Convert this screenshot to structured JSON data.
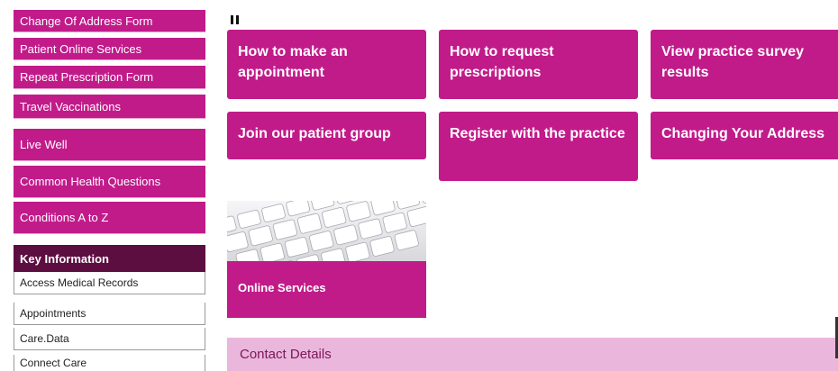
{
  "sidebar": {
    "forms": [
      "Change Of Address Form",
      "Patient Online Services",
      "Repeat Prescription Form",
      "Travel Vaccinations"
    ],
    "health": [
      "Live Well",
      "Common Health Questions",
      "Conditions A to Z"
    ],
    "key_information": {
      "title": "Key Information",
      "items": [
        "Access Medical Records",
        "Appointments",
        "Care.Data",
        "Connect Care"
      ]
    }
  },
  "main": {
    "tiles": [
      "How to make an appointment",
      "How to request prescriptions",
      "View practice survey results",
      "Join our patient group",
      "Register with the practice",
      "Changing Your Address"
    ],
    "online_services": {
      "label": "Online Services",
      "image": "keyboard-image"
    },
    "contact_details": "Contact Details"
  },
  "icons": {
    "slideshow_control": "pause-icon"
  },
  "colors": {
    "brand": "#c11b8a",
    "header_dark": "#5d0e41",
    "contact_bg": "#ebb6dc",
    "contact_text": "#7a1659"
  }
}
